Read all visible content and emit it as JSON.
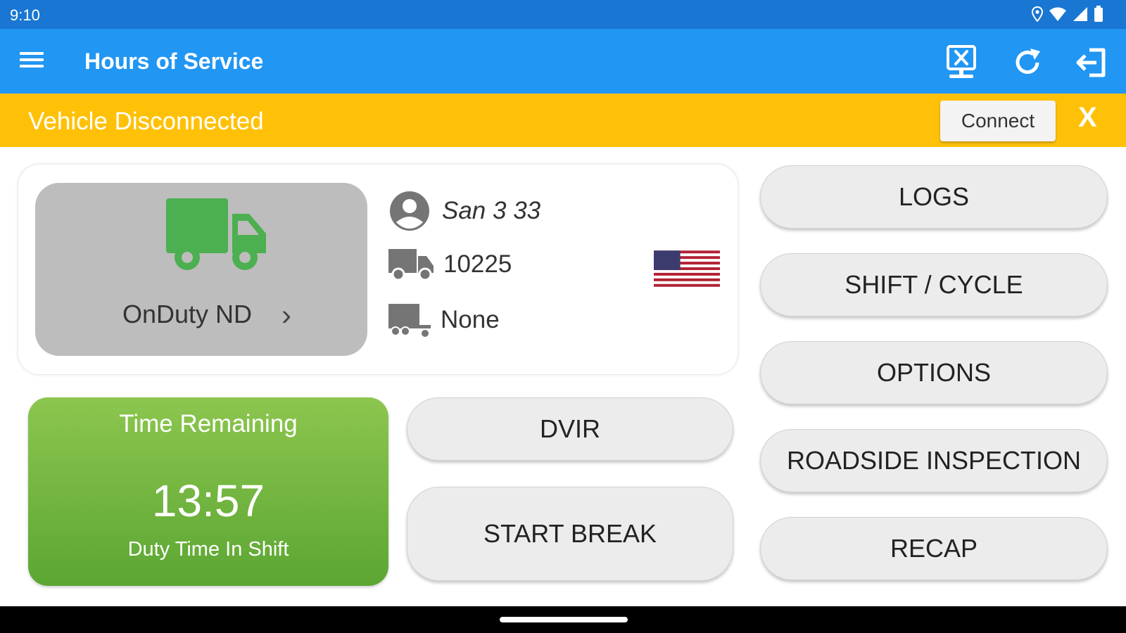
{
  "status_bar": {
    "time": "9:10"
  },
  "app_bar": {
    "title": "Hours of Service",
    "icons": [
      "menu-icon",
      "desktop-disconnect-icon",
      "refresh-icon",
      "logout-icon"
    ]
  },
  "banner": {
    "text": "Vehicle Disconnected",
    "connect_label": "Connect",
    "close_label": "X"
  },
  "duty_status": {
    "label": "OnDuty ND",
    "chevron": "›"
  },
  "driver": {
    "name": "San 3 33",
    "vehicle": "10225",
    "trailer": "None"
  },
  "time_remaining": {
    "title": "Time Remaining",
    "value": "13:57",
    "subtitle": "Duty Time In Shift"
  },
  "buttons": {
    "dvir": "DVIR",
    "start_break": "START BREAK",
    "logs": "LOGS",
    "shift_cycle": "SHIFT / CYCLE",
    "options": "OPTIONS",
    "roadside": "ROADSIDE INSPECTION",
    "recap": "RECAP"
  },
  "colors": {
    "status_bar": "#1976d2",
    "app_bar": "#2196f3",
    "banner": "#ffc107",
    "truck_green": "#4caf50",
    "time_green": "#7cbb45"
  }
}
